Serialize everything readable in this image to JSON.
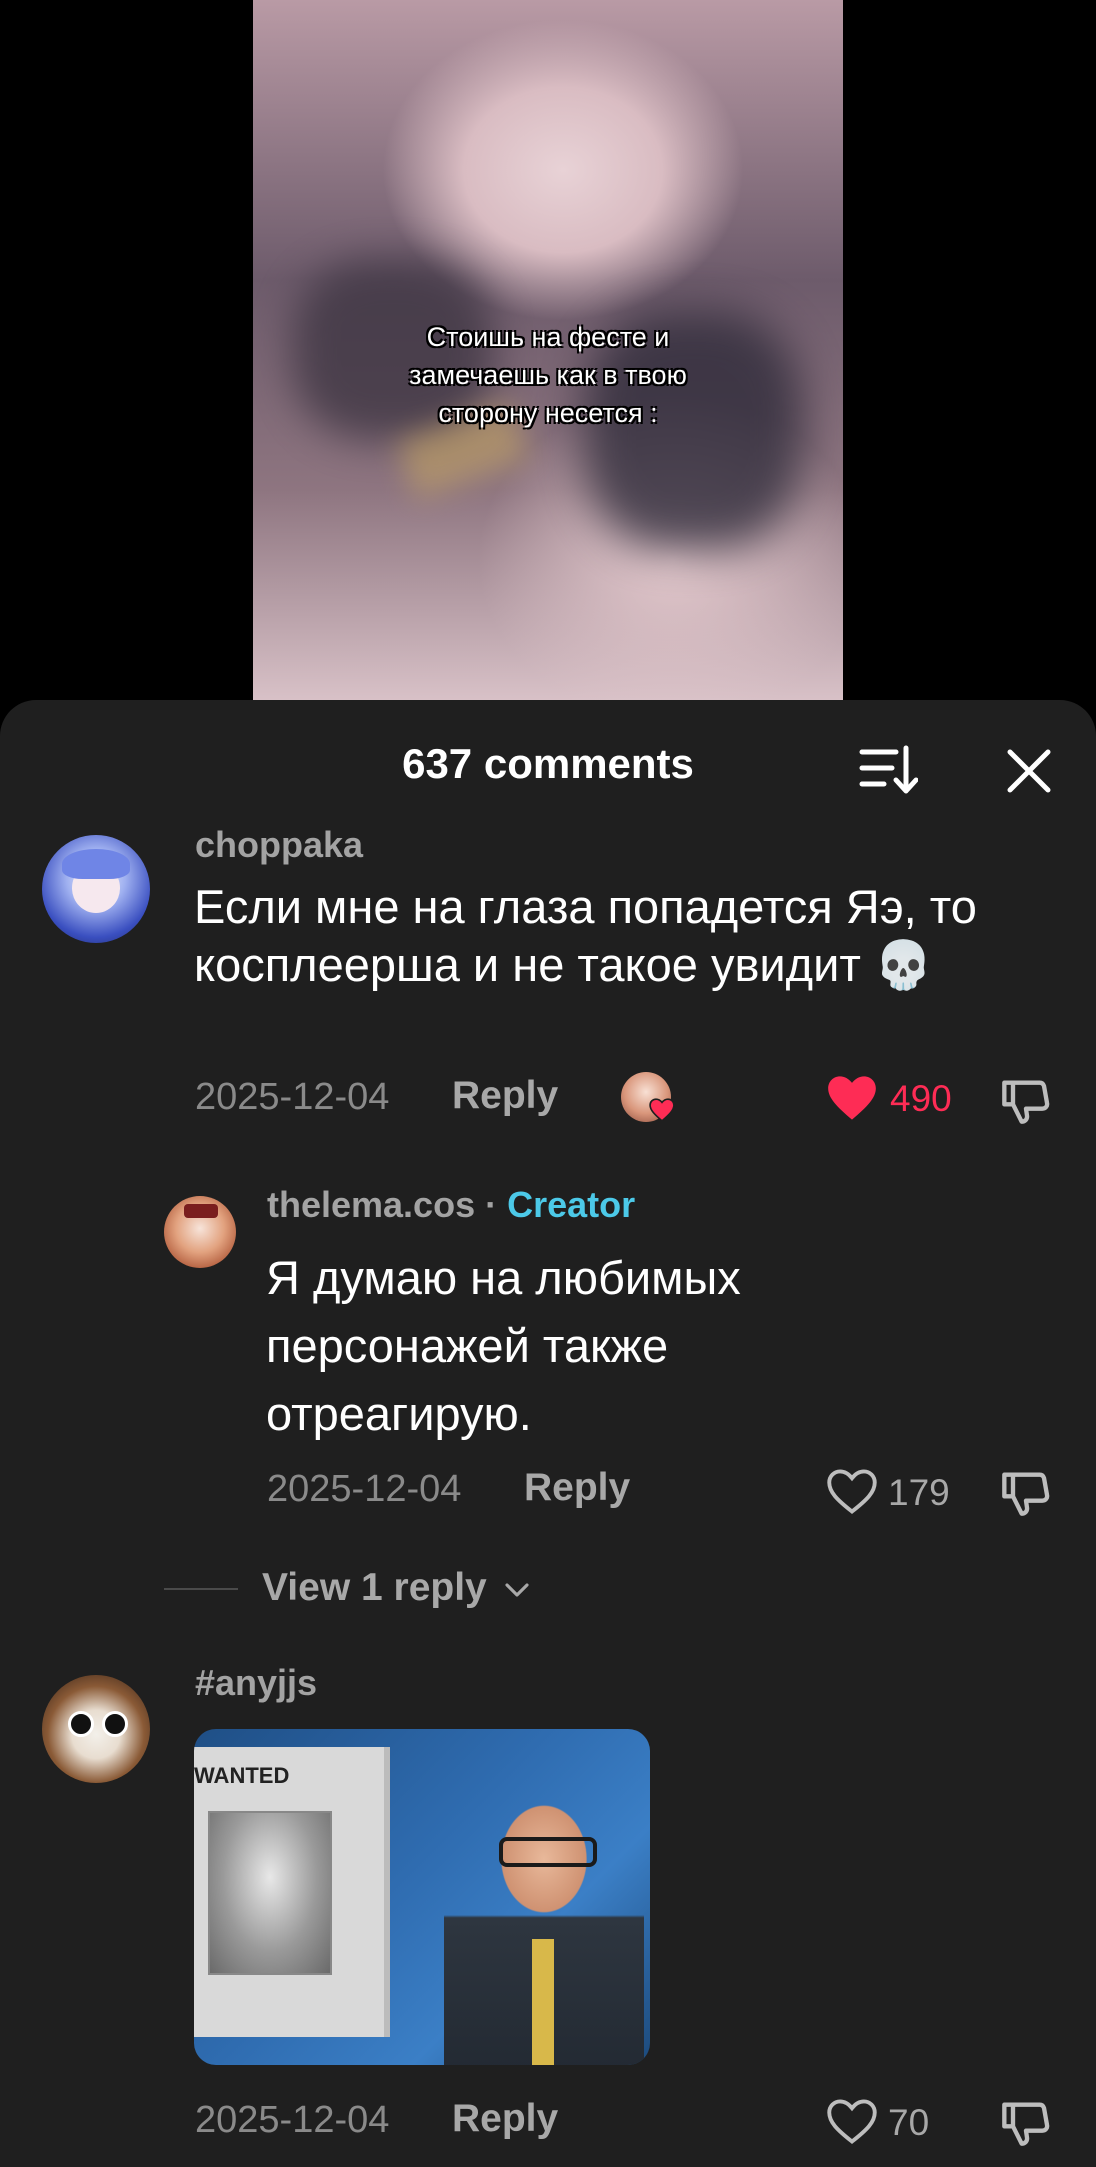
{
  "video": {
    "caption": "Стоишь на фесте и\nзамечаешь как в твою\nсторону несется :"
  },
  "comments_panel": {
    "title": "637 comments",
    "comments": [
      {
        "username": "choppaka",
        "text": "Если мне на глаза попадется Яэ, то косплеерша и не такое увидит 💀",
        "date": "2025-12-04",
        "reply_label": "Reply",
        "likes": "490",
        "liked": true,
        "creator_liked": true
      },
      {
        "username": "thelema.cos",
        "separator": "·",
        "badge": "Creator",
        "text": "Я думаю на любимых персонажей также отреагирую.",
        "date": "2025-12-04",
        "reply_label": "Reply",
        "likes": "179",
        "liked": false
      },
      {
        "username": "#anyjjs",
        "gif_text": "WANTED",
        "date": "2025-12-04",
        "reply_label": "Reply",
        "likes": "70",
        "liked": false
      }
    ],
    "view_replies_label": "View 1 reply"
  },
  "colors": {
    "panel_bg": "#1f1f1f",
    "like_red": "#fe2c55",
    "creator_blue": "#4cc9e8",
    "muted_text": "#8a8a8a"
  }
}
